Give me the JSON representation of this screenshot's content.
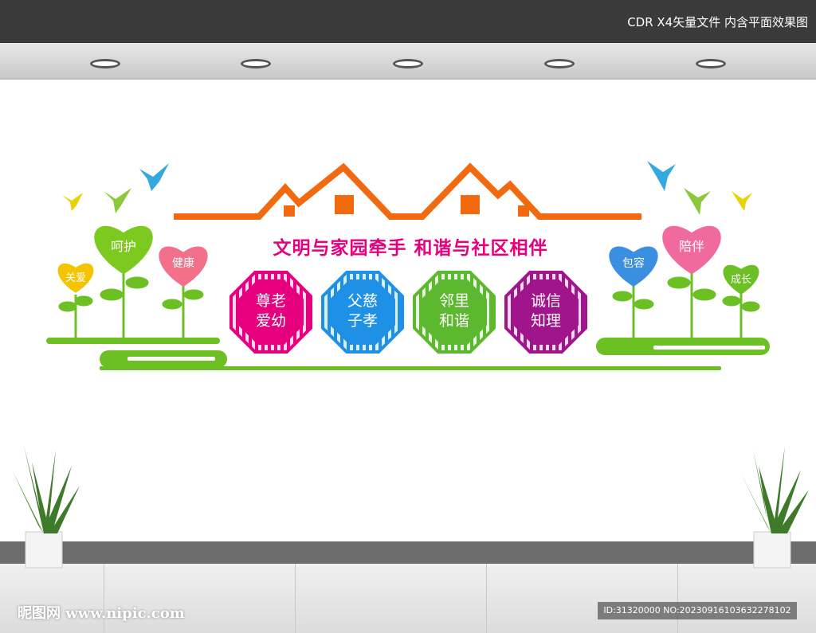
{
  "top_caption": "CDR X4矢量文件  内含平面效果图",
  "slogan": "文明与家园牵手  和谐与社区相伴",
  "panels": [
    {
      "line1": "尊老",
      "line2": "爱幼",
      "color": "#e6007e"
    },
    {
      "line1": "父慈",
      "line2": "子孝",
      "color": "#1e90e6"
    },
    {
      "line1": "邻里",
      "line2": "和谐",
      "color": "#5cb82e"
    },
    {
      "line1": "诚信",
      "line2": "知理",
      "color": "#a0158c"
    }
  ],
  "hearts_left": [
    {
      "label": "关爱",
      "color": "#f5c400"
    },
    {
      "label": "呵护",
      "color": "#7cc91f"
    },
    {
      "label": "健康",
      "color": "#f2708a"
    }
  ],
  "hearts_right": [
    {
      "label": "包容",
      "color": "#3b8fe0"
    },
    {
      "label": "陪伴",
      "color": "#f06aa0"
    },
    {
      "label": "成长",
      "color": "#6cc024"
    }
  ],
  "watermark": "昵图网 www.nipic.com",
  "id_text": "ID:31320000 NO:20230916103632278102",
  "colors": {
    "roof": "#f26a10",
    "grass": "#6cc024",
    "bird_blue": "#35a8e0",
    "bird_yellow": "#e8d200",
    "bird_green": "#8cc83c"
  }
}
